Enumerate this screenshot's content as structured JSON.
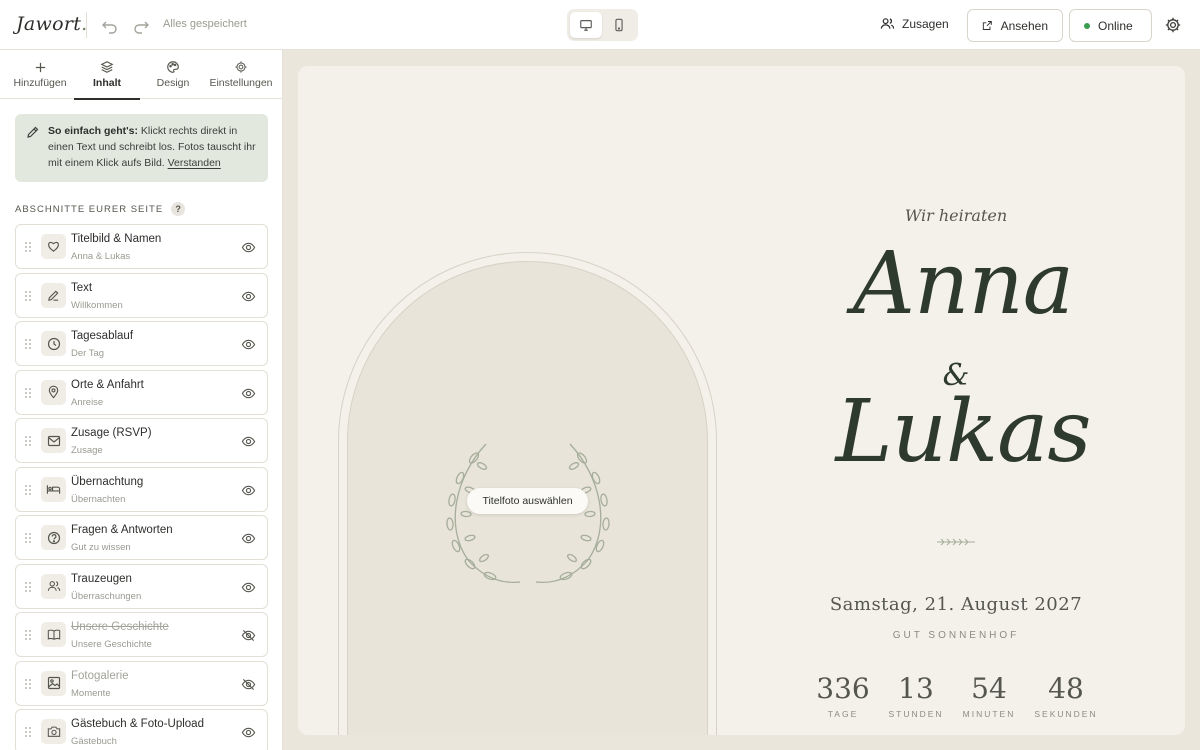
{
  "app": {
    "logo": "Jawort",
    "logo_dot": ".",
    "save_status": "Alles gespeichert"
  },
  "topbar": {
    "rsvp_label": "Zusagen",
    "view_label": "Ansehen",
    "online_label": "Online",
    "status_color": "#3a9c4f"
  },
  "tabs": [
    {
      "label": "Hinzufügen",
      "icon": "plus-icon"
    },
    {
      "label": "Inhalt",
      "icon": "layers-icon",
      "active": true
    },
    {
      "label": "Design",
      "icon": "palette-icon"
    },
    {
      "label": "Einstellungen",
      "icon": "gear-icon"
    }
  ],
  "tip": {
    "bold": "So einfach geht's:",
    "text": " Klickt rechts direkt in einen Text und schreibt los. Fotos tauscht ihr mit einem Klick aufs Bild. ",
    "link": "Verstanden"
  },
  "sections_label": "ABSCHNITTE EURER SEITE",
  "help_glyph": "?",
  "sections": [
    {
      "title": "Titelbild & Namen",
      "subtitle": "Anna & Lukas",
      "icon": "heart-icon",
      "visible": true
    },
    {
      "title": "Text",
      "subtitle": "Willkommen",
      "icon": "pen-icon",
      "visible": true
    },
    {
      "title": "Tagesablauf",
      "subtitle": "Der Tag",
      "icon": "clock-icon",
      "visible": true
    },
    {
      "title": "Orte & Anfahrt",
      "subtitle": "Anreise",
      "icon": "map-pin-icon",
      "visible": true
    },
    {
      "title": "Zusage (RSVP)",
      "subtitle": "Zusage",
      "icon": "mail-icon",
      "visible": true
    },
    {
      "title": "Übernachtung",
      "subtitle": "Übernachten",
      "icon": "bed-icon",
      "visible": true
    },
    {
      "title": "Fragen & Antworten",
      "subtitle": "Gut zu wissen",
      "icon": "question-icon",
      "visible": true
    },
    {
      "title": "Trauzeugen",
      "subtitle": "Überraschungen",
      "icon": "users-icon",
      "visible": true
    },
    {
      "title": "Unsere Geschichte",
      "subtitle": "Unsere Geschichte",
      "icon": "book-icon",
      "visible": false
    },
    {
      "title": "Fotogalerie",
      "subtitle": "Momente",
      "icon": "image-icon",
      "visible": false
    },
    {
      "title": "Gästebuch & Foto-Upload",
      "subtitle": "Gästebuch",
      "icon": "camera-icon",
      "visible": true
    }
  ],
  "preview": {
    "photo_button": "Titelfoto auswählen",
    "kicker": "Wir heiraten",
    "name1": "Anna",
    "amp": "&",
    "name2": "Lukas",
    "date": "Samstag, 21. August 2027",
    "venue": "GUT SONNENHOF",
    "countdown": [
      {
        "value": "336",
        "label": "TAGE"
      },
      {
        "value": "13",
        "label": "STUNDEN"
      },
      {
        "value": "54",
        "label": "MINUTEN"
      },
      {
        "value": "48",
        "label": "SEKUNDEN"
      }
    ]
  }
}
